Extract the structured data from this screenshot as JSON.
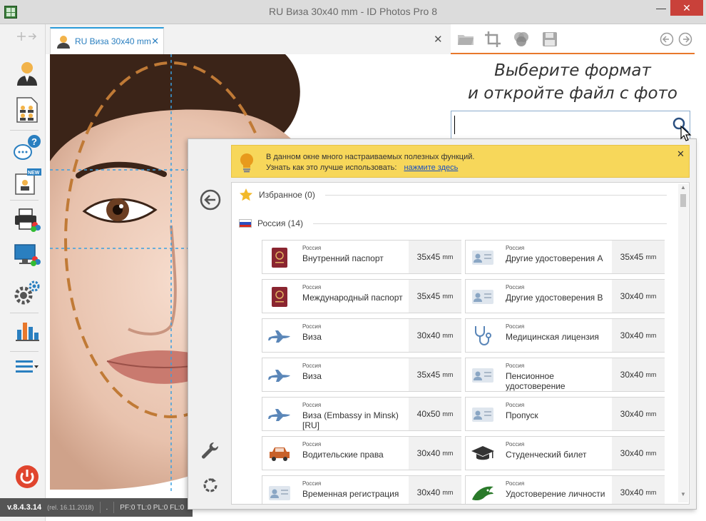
{
  "window": {
    "title": "RU Виза 30x40 mm - ID Photos Pro 8",
    "minimize": "—",
    "maximize": "☐",
    "close": "✕"
  },
  "tab": {
    "label": "RU Виза 30x40 mm",
    "close": "✕",
    "panel_close": "✕"
  },
  "right_panel": {
    "title_line1": "Выберите формат",
    "title_line2": "и откройте файл с фото",
    "search_value": "",
    "accent_color": "#e8782c"
  },
  "hint": {
    "line1": "В данном окне много настраиваемых полезных функций.",
    "line2": "Узнать как это лучше использовать:",
    "link": "нажмите здесь",
    "close": "✕",
    "color": "#f7d75a"
  },
  "groups": {
    "favorites": "Избранное (0)",
    "russia": "Россия (14)"
  },
  "cards": [
    {
      "country": "Россия",
      "name": "Внутренний паспорт",
      "size": "35x45",
      "unit": "mm",
      "icon": "passport-icon"
    },
    {
      "country": "Россия",
      "name": "Другие удостоверения А",
      "size": "35x45",
      "unit": "mm",
      "icon": "id-card-icon"
    },
    {
      "country": "Россия",
      "name": "Международный паспорт",
      "size": "35x45",
      "unit": "mm",
      "icon": "passport-icon"
    },
    {
      "country": "Россия",
      "name": "Другие удостоверения В",
      "size": "30x40",
      "unit": "mm",
      "icon": "id-card-icon"
    },
    {
      "country": "Россия",
      "name": "Виза",
      "size": "30x40",
      "unit": "mm",
      "icon": "airplane-icon"
    },
    {
      "country": "Россия",
      "name": "Медицинская лицензия",
      "size": "30x40",
      "unit": "mm",
      "icon": "stethoscope-icon"
    },
    {
      "country": "Россия",
      "name": "Виза",
      "size": "35x45",
      "unit": "mm",
      "icon": "airplane-icon"
    },
    {
      "country": "Россия",
      "name": "Пенсионное удостоверение",
      "size": "30x40",
      "unit": "mm",
      "icon": "id-card-icon"
    },
    {
      "country": "Россия",
      "name": "Виза (Embassy in Minsk) [RU]",
      "size": "40x50",
      "unit": "mm",
      "icon": "airplane-icon"
    },
    {
      "country": "Россия",
      "name": "Пропуск",
      "size": "30x40",
      "unit": "mm",
      "icon": "id-card-icon"
    },
    {
      "country": "Россия",
      "name": "Водительские права",
      "size": "30x40",
      "unit": "mm",
      "icon": "car-icon"
    },
    {
      "country": "Россия",
      "name": "Студенческий билет",
      "size": "30x40",
      "unit": "mm",
      "icon": "graduation-cap-icon"
    },
    {
      "country": "Россия",
      "name": "Временная регистрация",
      "size": "30x40",
      "unit": "mm",
      "icon": "id-card-icon"
    },
    {
      "country": "Россия",
      "name": "Удостоверение личности",
      "size": "30x40",
      "unit": "mm",
      "icon": "eagle-icon"
    }
  ],
  "status": {
    "version": "v.8.4.3.14",
    "release": "(rel. 16.11.2018)",
    "dot": ".",
    "counters": "PF:0 TL:0 PL:0 FL:0"
  }
}
